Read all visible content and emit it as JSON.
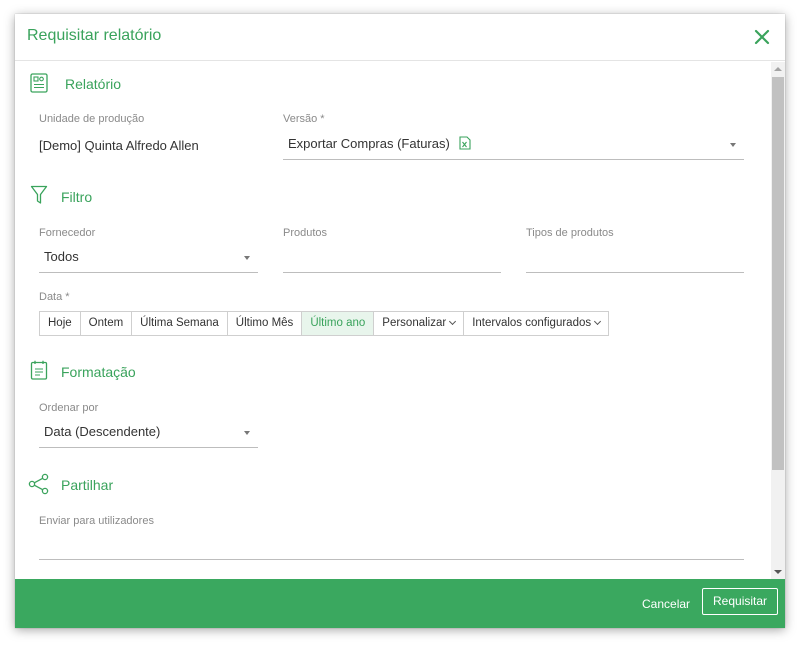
{
  "dialog": {
    "title": "Requisitar relatório"
  },
  "sections": {
    "report": {
      "title": "Relatório"
    },
    "filter": {
      "title": "Filtro"
    },
    "formatting": {
      "title": "Formatação"
    },
    "share": {
      "title": "Partilhar"
    }
  },
  "report": {
    "unit_label": "Unidade de produção",
    "unit_value": "[Demo] Quinta Alfredo Allen",
    "version_label": "Versão *",
    "version_value": "Exportar Compras (Faturas)"
  },
  "filter": {
    "supplier_label": "Fornecedor",
    "supplier_value": "Todos",
    "products_label": "Produtos",
    "products_value": "",
    "product_types_label": "Tipos de produtos",
    "product_types_value": "",
    "date_label": "Data *",
    "date_buttons": [
      "Hoje",
      "Ontem",
      "Última Semana",
      "Último Mês",
      "Último ano",
      "Personalizar",
      "Intervalos configurados"
    ],
    "date_active": "Último ano"
  },
  "formatting": {
    "order_label": "Ordenar por",
    "order_value": "Data (Descendente)"
  },
  "share": {
    "send_label": "Enviar para utilizadores",
    "send_value": ""
  },
  "footer": {
    "cancel_label": "Cancelar",
    "request_label": "Requisitar"
  },
  "colors": {
    "accent": "#3aa35c",
    "footer_bg": "#3aa85f",
    "active_date_bg": "#e8f5ec"
  },
  "icons": {
    "close": "close-icon",
    "report": "report-icon",
    "excel": "excel-file-icon",
    "filter": "filter-icon",
    "formatting": "clipboard-list-icon",
    "share": "share-icon"
  }
}
